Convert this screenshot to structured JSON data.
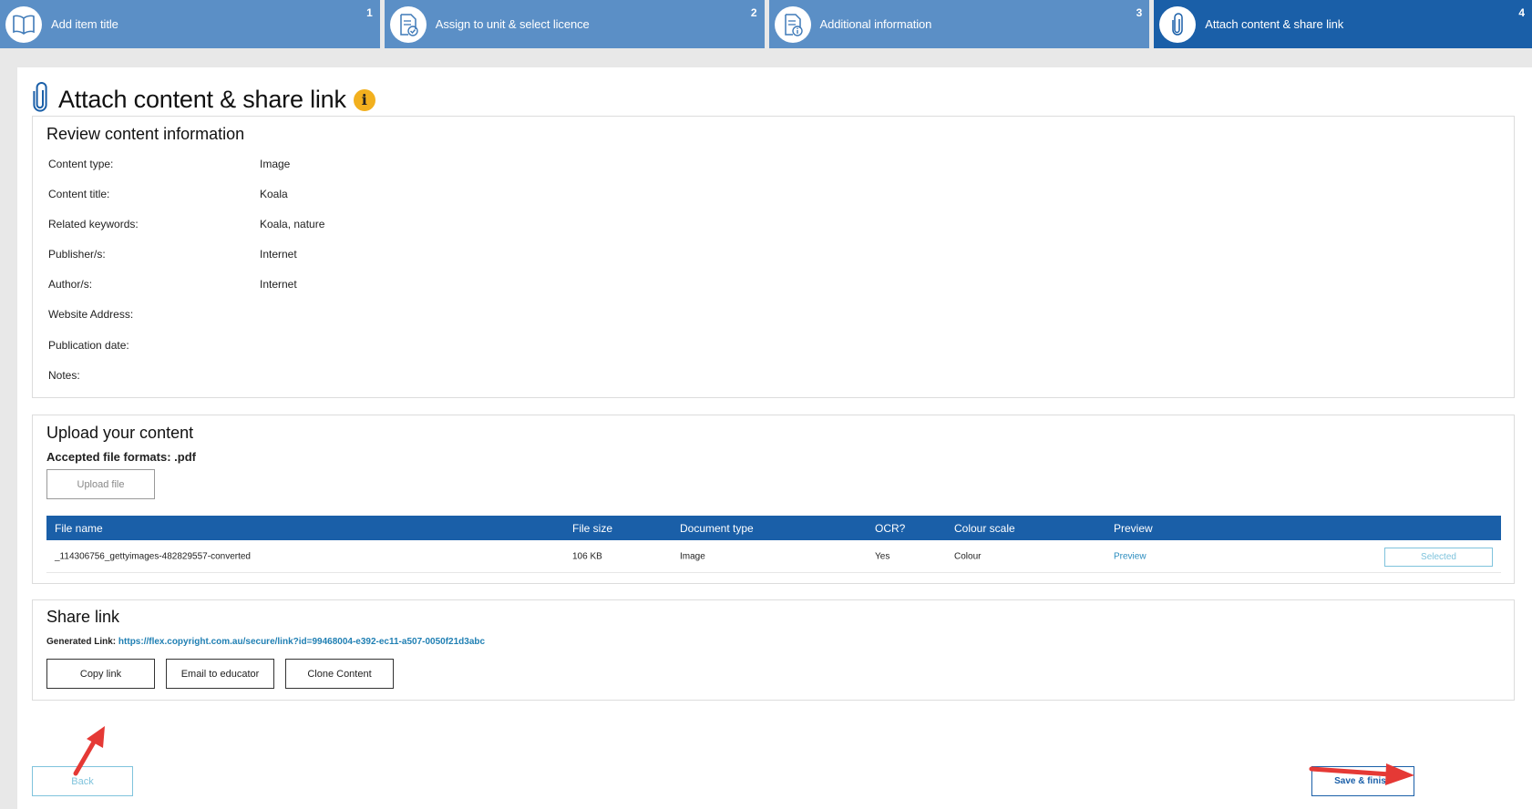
{
  "stepper": {
    "steps": [
      {
        "label": "Add item title",
        "number": "1",
        "icon": "book-icon"
      },
      {
        "label": "Assign to unit & select licence",
        "number": "2",
        "icon": "document-check-icon"
      },
      {
        "label": "Additional information",
        "number": "3",
        "icon": "document-info-icon"
      },
      {
        "label": "Attach content & share link",
        "number": "4",
        "icon": "paperclip-icon",
        "active": true
      }
    ]
  },
  "page": {
    "title": "Attach content & share link",
    "info_icon": "i"
  },
  "review": {
    "heading": "Review content information",
    "fields": [
      {
        "label": "Content type:",
        "value": "Image"
      },
      {
        "label": "Content title:",
        "value": "Koala"
      },
      {
        "label": "Related keywords:",
        "value": "Koala, nature"
      },
      {
        "label": "Publisher/s:",
        "value": "Internet"
      },
      {
        "label": "Author/s:",
        "value": "Internet"
      },
      {
        "label": "Website Address:",
        "value": ""
      },
      {
        "label": "Publication date:",
        "value": ""
      },
      {
        "label": "Notes:",
        "value": ""
      }
    ]
  },
  "upload": {
    "heading": "Upload your content",
    "formats": "Accepted file formats: .pdf",
    "upload_button": "Upload file",
    "table": {
      "headers": [
        "File name",
        "File size",
        "Document type",
        "OCR?",
        "Colour scale",
        "Preview"
      ],
      "rows": [
        {
          "file_name": "_114306756_gettyimages-482829557-converted",
          "file_size": "106 KB",
          "document_type": "Image",
          "ocr": "Yes",
          "colour_scale": "Colour",
          "preview": "Preview",
          "action": "Selected"
        }
      ]
    }
  },
  "share": {
    "heading": "Share link",
    "generated_label": "Generated Link:",
    "generated_url": "https://flex.copyright.com.au/secure/link?id=99468004-e392-ec11-a507-0050f21d3abc",
    "buttons": {
      "copy": "Copy link",
      "email": "Email to educator",
      "clone": "Clone Content"
    }
  },
  "footer": {
    "back": "Back",
    "save": "Save & finish"
  },
  "colors": {
    "step_inactive": "#5b8fc6",
    "step_active": "#1a5fa8",
    "table_header": "#1a5fa8",
    "link": "#1f7fb3",
    "info": "#f2b01e",
    "annotation_arrow": "#e53935"
  }
}
